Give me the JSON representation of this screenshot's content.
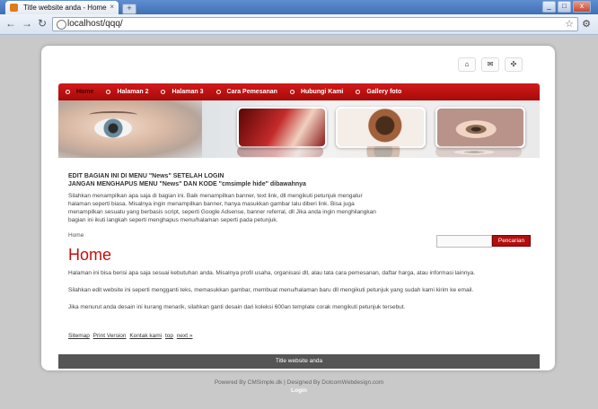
{
  "browser": {
    "tab_title": "Title website anda - Home",
    "new_tab": "+",
    "url": "localhost/qqq/",
    "window_buttons": [
      "_",
      "□",
      "x"
    ],
    "nav": {
      "back": "←",
      "forward": "→",
      "reload": "↻"
    },
    "star": "☆",
    "wrench": "🔧"
  },
  "top_icons": [
    {
      "name": "home-icon",
      "glyph": "⌂"
    },
    {
      "name": "mail-icon",
      "glyph": "✉"
    },
    {
      "name": "sitemap-icon",
      "glyph": "✣"
    }
  ],
  "menu": {
    "items": [
      "Home",
      "Halaman 2",
      "Halaman 3",
      "Cara Pemesanan",
      "Hubungi Kami",
      "Gallery foto"
    ],
    "active_index": 0
  },
  "intro": {
    "heading_line1": "EDIT BAGIAN INI DI MENU \"News\" SETELAH LOGIN",
    "heading_line2": "JANGAN MENGHAPUS MENU \"News\" DAN KODE \"cmsimple hide\" dibawahnya",
    "text": "Silahkan menampilkan apa saja di bagian ini. Baik menampilkan banner, text link, dll mengikuti petunjuk mengatur halaman seperti biasa. Misalnya ingin menampilkan banner, hanya masukkan gambar lalu diberi link. Bisa juga menampilkan sesuatu yang berbasis script, seperti Google Adsense, banner referral, dll Jika anda ingin menghilangkan bagian ini ikuti langkah seperti menghapus menu/halaman seperti pada petunjuk."
  },
  "breadcrumb": "Home",
  "search": {
    "placeholder": "",
    "button": "Pencarian"
  },
  "page": {
    "title": "Home",
    "paragraphs": [
      "Halaman ini bisa berisi apa saja sesuai kebutuhan anda. Misalnya profil usaha, organisasi dll, alau tata cara pemesanan, daftar harga, atau informasi lainnya.",
      "Silahkan edit website ini seperti mengganti teks, memasukkan gambar, membuat menu/halaman baru dll mengikuti petunjuk yang sudah kami kirim ke email.",
      "Jika menurut anda desain ini kurang menarik, silahkan ganti desain dari koleksi 600an template corak mengikuti petunjuk tersebut."
    ]
  },
  "footer_links": [
    "Sitemap",
    "Print Version",
    "Kontak kami",
    "top",
    "next »"
  ],
  "footer_bar": "Title website anda",
  "credits": "Powered By CMSimple.dk | Designed By DotcomWebdesign.com",
  "login": "Login"
}
